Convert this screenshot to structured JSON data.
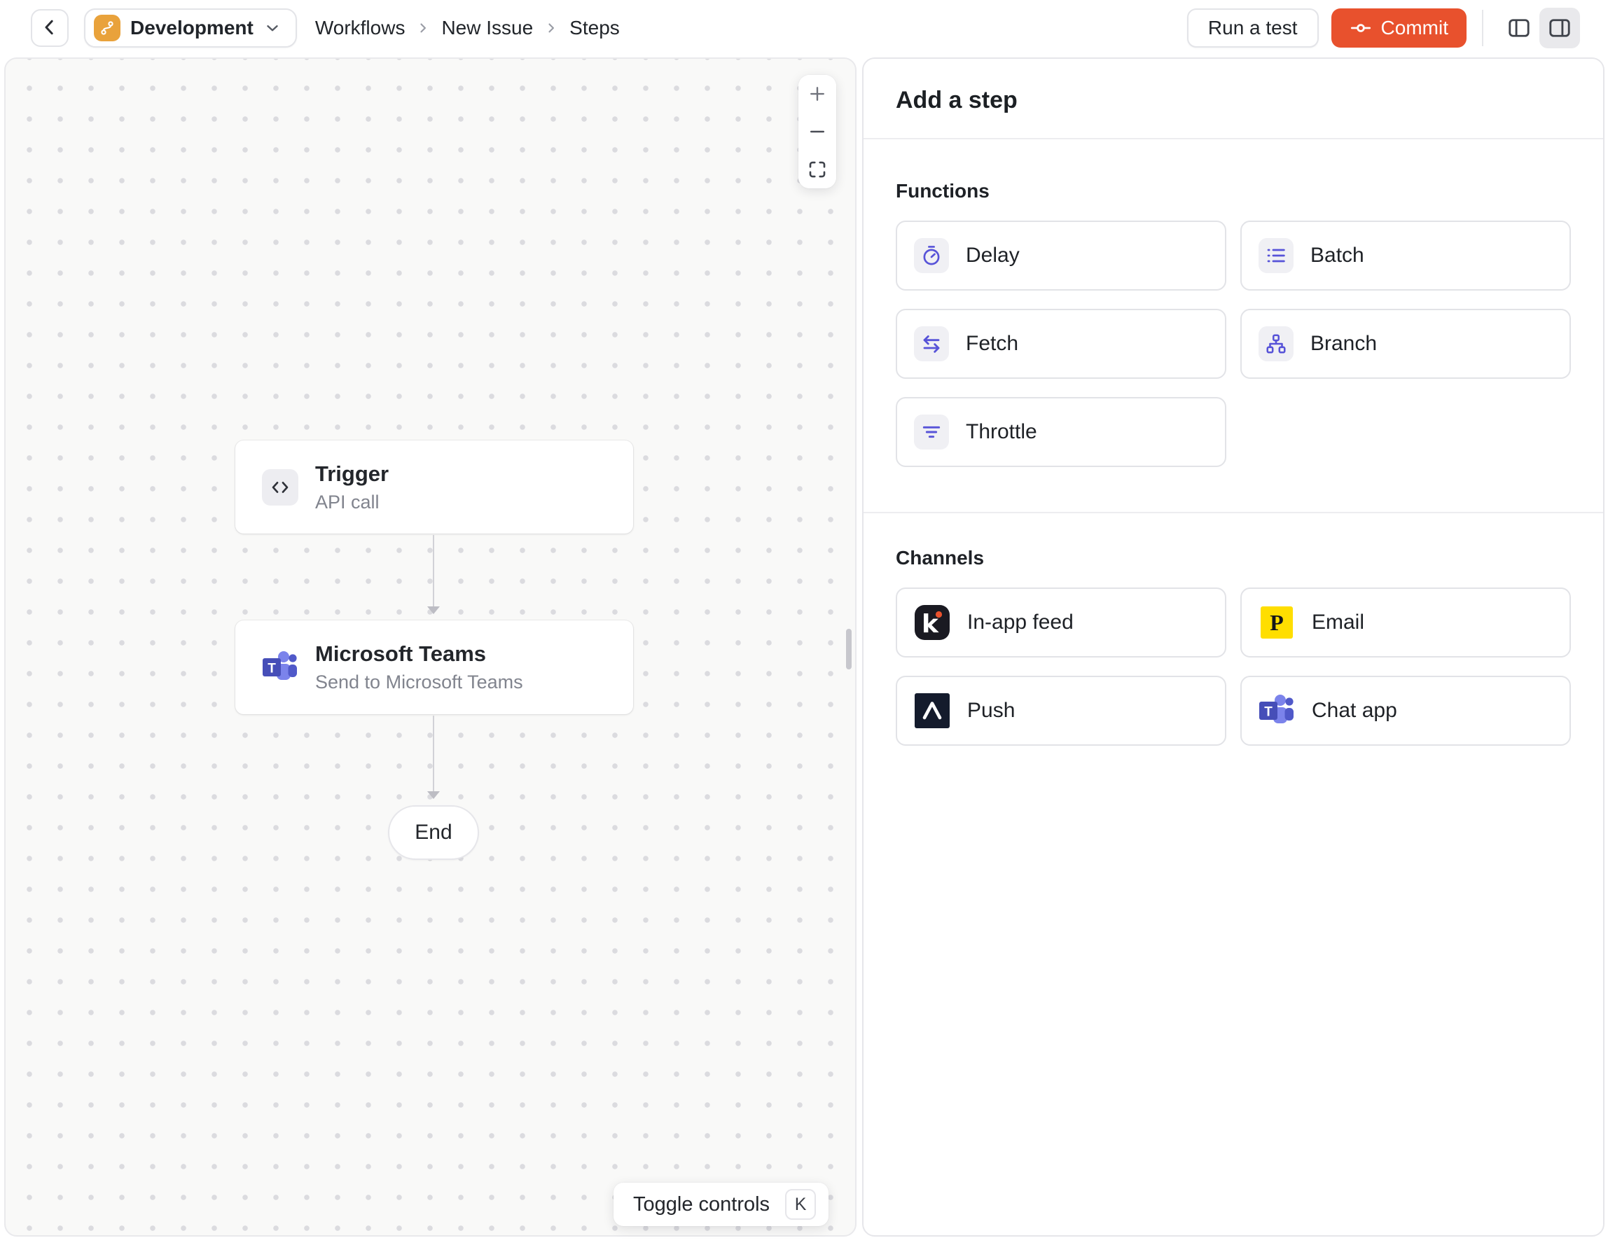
{
  "topbar": {
    "back_icon": "chevron-left-icon",
    "environment": {
      "label": "Development",
      "icon": "git-branch-icon",
      "icon_bg": "#E9A23B"
    },
    "breadcrumb": {
      "items": [
        "Workflows",
        "New Issue",
        "Steps"
      ],
      "separator_icon": "chevron-right-icon"
    },
    "actions": {
      "run_test_label": "Run a test",
      "commit_label": "Commit",
      "commit_icon": "git-commit-icon",
      "commit_bg": "#E8512D",
      "layout_toggles": [
        "panel-left-icon",
        "panel-right-icon"
      ],
      "active_layout_toggle": "panel-right-icon"
    }
  },
  "canvas": {
    "zoom_controls": {
      "zoom_in": "plus-icon",
      "zoom_out": "minus-icon",
      "fit_view": "fit-view-icon"
    },
    "nodes": {
      "trigger": {
        "title": "Trigger",
        "subtitle": "API call",
        "icon": "code-icon"
      },
      "teams": {
        "title": "Microsoft Teams",
        "subtitle": "Send to Microsoft Teams",
        "icon": "microsoft-teams-logo"
      },
      "end": {
        "label": "End"
      }
    },
    "toggle_controls": {
      "label": "Toggle controls",
      "shortcut": "K"
    }
  },
  "panel": {
    "title": "Add a step",
    "functions": {
      "label": "Functions",
      "items": [
        {
          "label": "Delay",
          "icon": "stopwatch-icon"
        },
        {
          "label": "Batch",
          "icon": "list-icon"
        },
        {
          "label": "Fetch",
          "icon": "swap-arrows-icon"
        },
        {
          "label": "Branch",
          "icon": "hierarchy-icon"
        },
        {
          "label": "Throttle",
          "icon": "filter-icon"
        }
      ]
    },
    "channels": {
      "label": "Channels",
      "items": [
        {
          "label": "In-app feed",
          "icon": "knock-logo"
        },
        {
          "label": "Email",
          "icon": "postmark-logo"
        },
        {
          "label": "Push",
          "icon": "expo-logo"
        },
        {
          "label": "Chat app",
          "icon": "microsoft-teams-logo"
        }
      ]
    }
  },
  "colors": {
    "accent_orange": "#E8512D",
    "environment_amber": "#E9A23B",
    "function_icon_indigo": "#5753D8",
    "knock_dark": "#1A1A22",
    "postmark_yellow": "#FFDE00",
    "expo_dark": "#141B2C",
    "teams_purple": "#464EB8",
    "canvas_bg": "#F9F9F8"
  }
}
